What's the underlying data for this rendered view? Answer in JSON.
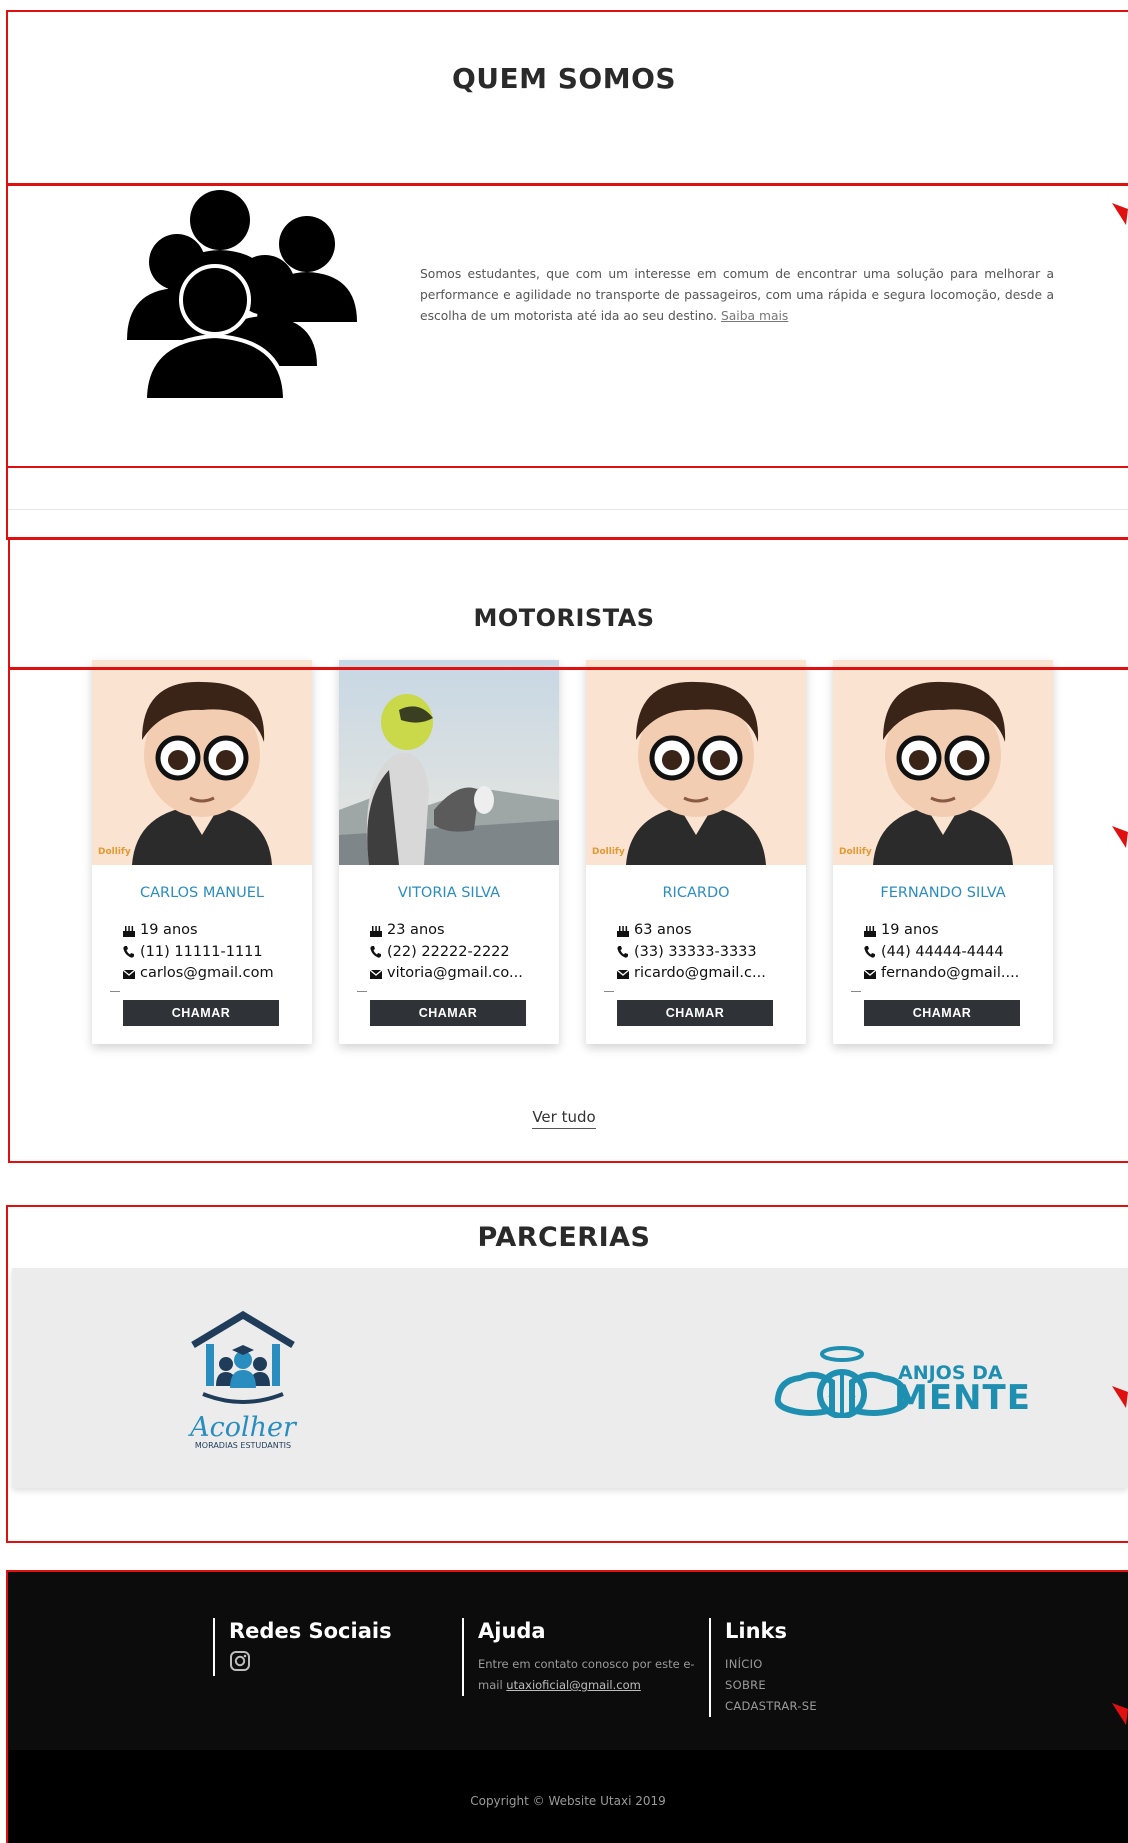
{
  "quem_somos": {
    "title": "QUEM SOMOS",
    "text": "Somos estudantes, que com um interesse em comum de encontrar uma solução para melhorar a performance e agilidade no transporte de passageiros, com uma rápida e segura locomoção, desde a escolha de um motorista até ida ao seu destino.",
    "link": "Saiba mais"
  },
  "motoristas": {
    "title": "MOTORISTAS",
    "cards": [
      {
        "name": "CARLOS MANUEL",
        "age": "19 anos",
        "phone": "(11) 11111-1111",
        "email": "carlos@gmail.com",
        "button": "CHAMAR",
        "watermark": "Dollify"
      },
      {
        "name": "VITORIA SILVA",
        "age": "23 anos",
        "phone": "(22) 22222-2222",
        "email": "vitoria@gmail.co...",
        "button": "CHAMAR"
      },
      {
        "name": "RICARDO",
        "age": "63 anos",
        "phone": "(33) 33333-3333",
        "email": "ricardo@gmail.c...",
        "button": "CHAMAR",
        "watermark": "Dollify"
      },
      {
        "name": "FERNANDO SILVA",
        "age": "19 anos",
        "phone": "(44) 44444-4444",
        "email": "fernando@gmail....",
        "button": "CHAMAR",
        "watermark": "Dollify"
      }
    ],
    "see_all": "Ver tudo"
  },
  "parcerias": {
    "title": "PARCERIAS",
    "partners": [
      {
        "name": "Acolher",
        "subtitle": "MORADIAS ESTUDANTIS"
      },
      {
        "name_line1": "ANJOS DA",
        "name_line2": "MENTE"
      }
    ]
  },
  "footer": {
    "social": {
      "title": "Redes Sociais",
      "icon": "instagram-icon"
    },
    "help": {
      "title": "Ajuda",
      "text": "Entre em contato conosco por este e-mail",
      "email": "utaxioficial@gmail.com"
    },
    "links": {
      "title": "Links",
      "items": [
        "INÍCIO",
        "SOBRE",
        "CADASTRAR-SE"
      ]
    },
    "copyright": "Copyright © Website Utaxi 2019"
  },
  "colors": {
    "accent": "#2a8dbf",
    "annotation": "#e01010",
    "button": "#2f3338",
    "footer": "#0c0c0c"
  }
}
